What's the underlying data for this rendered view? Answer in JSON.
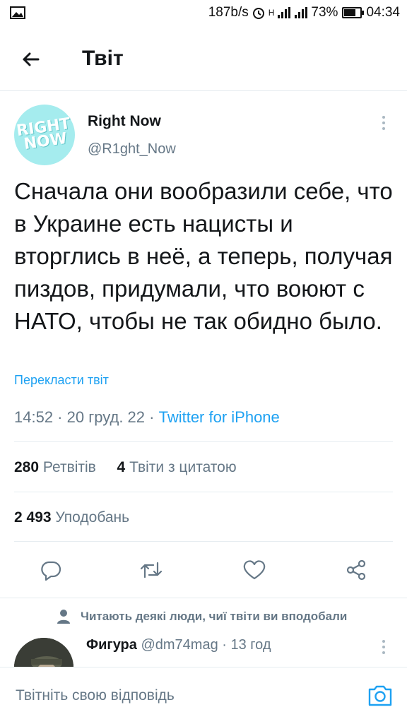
{
  "status_bar": {
    "speed": "187b/s",
    "network": "H",
    "battery_percent": "73%",
    "time": "04:34",
    "battery_level": 0.73
  },
  "header": {
    "title": "Твіт"
  },
  "tweet": {
    "author_name": "Right Now",
    "author_handle": "@R1ght_Now",
    "avatar_text": "RIGHT NOW",
    "text": "Сначала они вообразили себе, что в Украине есть нацисты и вторглись в неё, а теперь, получая пиздов, придумали, что воюют с НАТО, чтобы не так обидно было.",
    "translate_label": "Перекласти твіт",
    "time": "14:52",
    "date": "20 груд. 22",
    "source": "Twitter for iPhone",
    "separator": " · "
  },
  "stats": {
    "retweets_count": "280",
    "retweets_label": "Ретвітів",
    "quotes_count": "4",
    "quotes_label": "Твіти з цитатою",
    "likes_count": "2 493",
    "likes_label": "Уподобань"
  },
  "social_context": "Читають деякі люди, чиї твіти ви вподобали",
  "reply": {
    "name": "Фигура",
    "handle": "@dm74mag",
    "time": "13 год",
    "separator": " · "
  },
  "compose": {
    "placeholder": "Твітніть свою відповідь"
  },
  "colors": {
    "accent": "#1da1f2",
    "secondary_text": "#657786",
    "divider": "#e6ecf0",
    "avatar_bg": "#a5ecee"
  }
}
